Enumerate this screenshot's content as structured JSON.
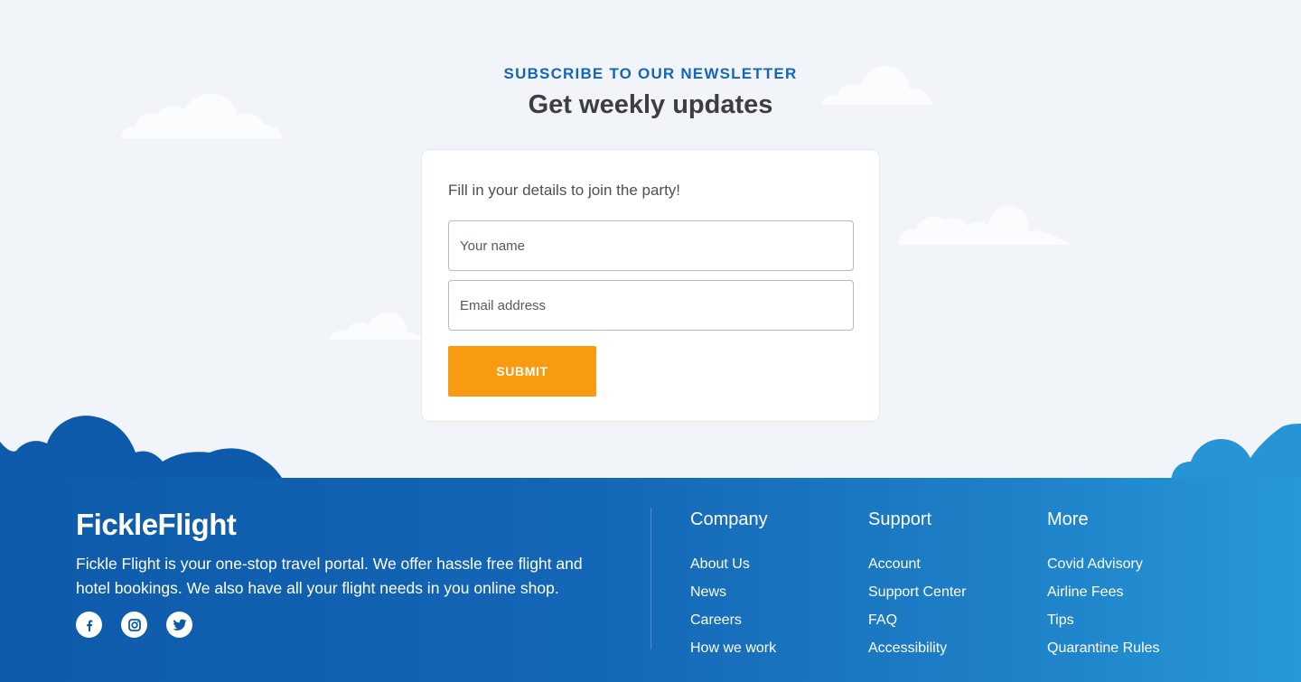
{
  "newsletter": {
    "eyebrow": "SUBSCRIBE TO OUR NEWSLETTER",
    "title": "Get weekly updates"
  },
  "form": {
    "intro": "Fill in your details to join the party!",
    "name_placeholder": "Your name",
    "email_placeholder": "Email address",
    "submit_label": "SUBMIT"
  },
  "footer": {
    "logo": "FickleFlight",
    "about": "Fickle Flight is your one-stop travel portal. We offer hassle free flight and hotel bookings. We also have all your flight needs in you online shop.",
    "socials": [
      "facebook-icon",
      "instagram-icon",
      "twitter-icon"
    ],
    "columns": [
      {
        "title": "Company",
        "links": [
          "About Us",
          "News",
          "Careers",
          "How we work"
        ]
      },
      {
        "title": "Support",
        "links": [
          "Account",
          "Support Center",
          "FAQ",
          "Accessibility"
        ]
      },
      {
        "title": "More",
        "links": [
          "Covid Advisory",
          "Airline Fees",
          "Tips",
          "Quarantine Rules"
        ]
      }
    ]
  },
  "colors": {
    "background": "#f1f4f9",
    "accent": "#1565b8",
    "submit": "#f99b10",
    "footer_start": "#0e5aaa",
    "footer_end": "#2898d8"
  }
}
